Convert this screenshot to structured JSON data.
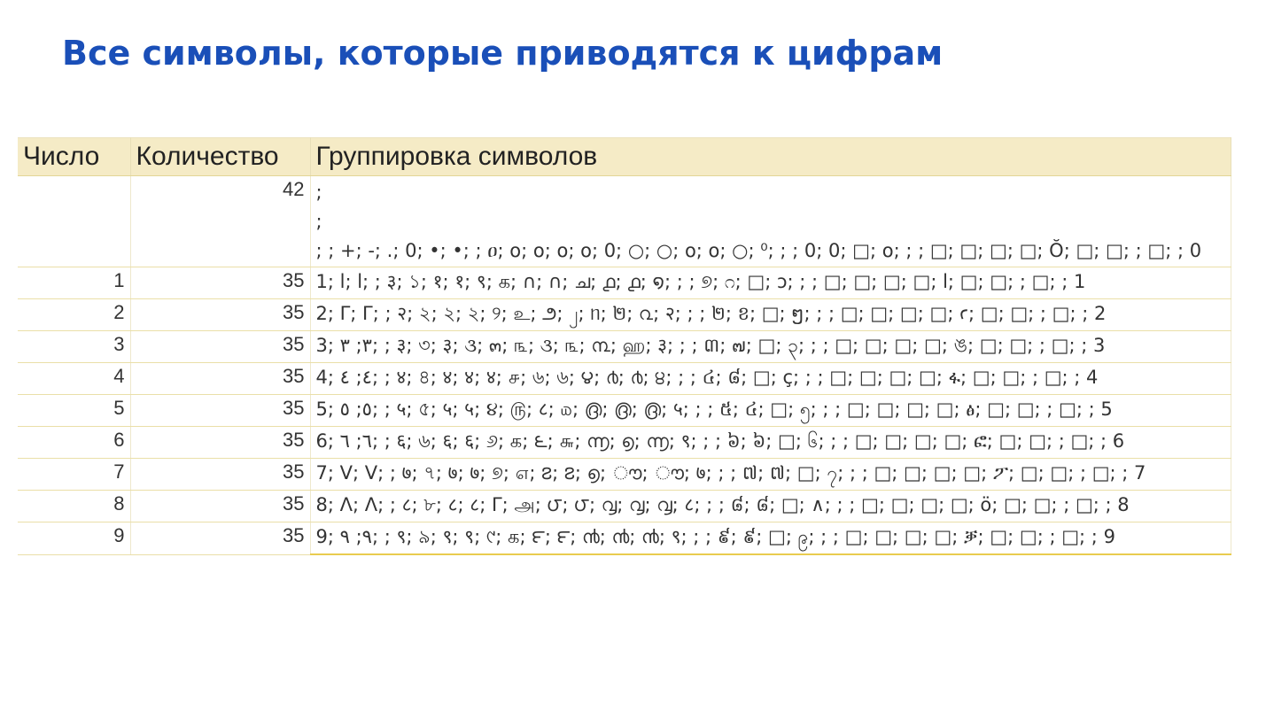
{
  "title": "Все символы, которые приводятся к цифрам",
  "table": {
    "headers": [
      "Число",
      "Количество",
      "Группировка символов"
    ],
    "zero_row": {
      "number": "",
      "count": "42",
      "symbol_lines": [
        "   ;",
        ";",
        ";  ; +; -; .; 0; •; •; ; ዐ; ο; ο; ο; ο; 0; ○; ○; ο; ο; ○; ⁰; ; ; 0; 0; □; ο; ; ; □; □; □; □; Ŏ; □; □; ; □; ;  0"
      ]
    },
    "rows": [
      {
        "number": "1",
        "count": "35",
        "symbols": "1; l; l; ; ३; ১; १; १; ९; க; ∩; ∩; ച; ൧; ൧; ໑; ; ; ୭; ೧; □; ɔ; ; ; □; □; □; □; l; □; □; ; □; ;  1"
      },
      {
        "number": "2",
        "count": "35",
        "symbols": "2; Γ; Γ; ; २; ২; ২; ২; ୨; உ; ౨; ၂; ᥒ; ២; ൨; २; ; ; ២; ខ; □; ໆ; ; ; □; □; □; □; ꜥ; □; □; ; □; ;  2"
      },
      {
        "number": "3",
        "count": "35",
        "symbols": "3; ٣; ٣; ; ३; ৩; ३; ૩; ๓; ௩; ૩; ௩; ൩; ஹ; ३; ; ; ៣; ๗; □; ၃; ; ; □; □; □; □; ঙ; □; □; ; □; ;  3"
      },
      {
        "number": "4",
        "count": "35",
        "symbols": "4; ٤; ٤; ; ४; ৪; ४; ४; ४; ௪; ৬; ৬; ౪; ൪; ൪; ੪; ; ; ៤; ៨; □; ç; ; ; □; □; □; □; ፋ; □; □; ; □; ;  4"
      },
      {
        "number": "5",
        "count": "35",
        "symbols": "5; ٥; ٥; ; ५; ৫; ५; ५; ૪; ௫; ८; ௰; ൫; ൫; ൫; ५; ; ; ៥; ៤; □; ၅; ; ; □; □; □; □; ፅ; □; □; ; □; ;  5"
      },
      {
        "number": "6",
        "count": "35",
        "symbols": "6; ٦; ٦; ; ६; ৬; ६; ६; ୬; க; ౬; ௬; ൬; ൭; ൬; ९; ; ; ៦; ៦; □; ၆; ; ; □; □; □; □; ፎ; □; □; ; □; ;  6"
      },
      {
        "number": "7",
        "count": "35",
        "symbols": "7; V; V; ; ७; ৭; ७; ७; ୭; ௭; ౭; ౭; ൭; ൗ; ൗ; ७; ; ; ៧; ៧; □; ၇; ; ; □; □; □; □; ፖ; □; □; ; □; ;  7"
      },
      {
        "number": "8",
        "count": "35",
        "symbols": "8; Λ; Λ; ; ८; ৮; ८; ८; Γ; அ; ౮; ౮; ൮; ൮; ൮; ८; ; ; ៨; ៨; □; ∧; ; ; □; □; □; □; ö; □; □; ; □; ;  8"
      },
      {
        "number": "9",
        "count": "35",
        "symbols": "9; ٩; ٩; ; ९; ৯; ९; ९; ୯; க; ౯; ౯; ൯; ൯; ൯; ९; ; ; ៩; ៩; □; ၉; ; ; □; □; □; □; ቓ; □; □; ; □; ;  9"
      }
    ]
  }
}
